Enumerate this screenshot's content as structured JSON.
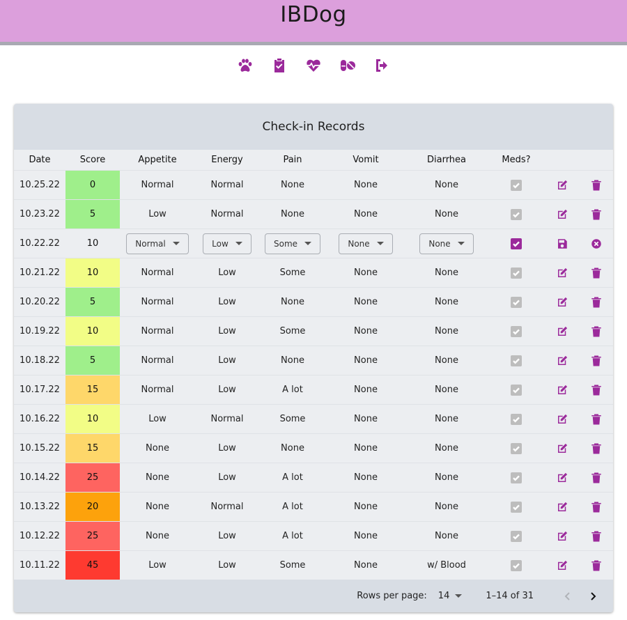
{
  "app": {
    "title": "IBDog"
  },
  "nav": [
    {
      "name": "paw-icon",
      "icon": "paw"
    },
    {
      "name": "clipboard-check-icon",
      "icon": "clipboard-check"
    },
    {
      "name": "heart-pulse-icon",
      "icon": "heart-pulse"
    },
    {
      "name": "pills-icon",
      "icon": "pills"
    },
    {
      "name": "logout-icon",
      "icon": "logout"
    }
  ],
  "table": {
    "title": "Check-in Records",
    "columns": [
      "Date",
      "Score",
      "Appetite",
      "Energy",
      "Pain",
      "Vomit",
      "Diarrhea",
      "Meds?"
    ],
    "score_colors": {
      "0": "#9fef8b",
      "5": "#9fef8b",
      "10": "#f2fd86",
      "15": "#fed76a",
      "20": "#fda20c",
      "25": "#fe6460",
      "45": "#fe3a30"
    },
    "accent_color": "#9b2a9b",
    "rows": [
      {
        "date": "10.25.22",
        "score": "0",
        "appetite": "Normal",
        "energy": "Normal",
        "pain": "None",
        "vomit": "None",
        "diarrhea": "None",
        "meds": true
      },
      {
        "date": "10.23.22",
        "score": "5",
        "appetite": "Low",
        "energy": "Normal",
        "pain": "None",
        "vomit": "None",
        "diarrhea": "None",
        "meds": true
      },
      {
        "date": "10.22.22",
        "score": "10",
        "appetite": "Normal",
        "energy": "Low",
        "pain": "Some",
        "vomit": "None",
        "diarrhea": "None",
        "meds": true,
        "editing": true
      },
      {
        "date": "10.21.22",
        "score": "10",
        "appetite": "Normal",
        "energy": "Low",
        "pain": "Some",
        "vomit": "None",
        "diarrhea": "None",
        "meds": true
      },
      {
        "date": "10.20.22",
        "score": "5",
        "appetite": "Normal",
        "energy": "Low",
        "pain": "None",
        "vomit": "None",
        "diarrhea": "None",
        "meds": true
      },
      {
        "date": "10.19.22",
        "score": "10",
        "appetite": "Normal",
        "energy": "Low",
        "pain": "Some",
        "vomit": "None",
        "diarrhea": "None",
        "meds": true
      },
      {
        "date": "10.18.22",
        "score": "5",
        "appetite": "Normal",
        "energy": "Low",
        "pain": "None",
        "vomit": "None",
        "diarrhea": "None",
        "meds": true
      },
      {
        "date": "10.17.22",
        "score": "15",
        "appetite": "Normal",
        "energy": "Low",
        "pain": "A lot",
        "vomit": "None",
        "diarrhea": "None",
        "meds": true
      },
      {
        "date": "10.16.22",
        "score": "10",
        "appetite": "Low",
        "energy": "Normal",
        "pain": "Some",
        "vomit": "None",
        "diarrhea": "None",
        "meds": true
      },
      {
        "date": "10.15.22",
        "score": "15",
        "appetite": "None",
        "energy": "Low",
        "pain": "None",
        "vomit": "None",
        "diarrhea": "None",
        "meds": true
      },
      {
        "date": "10.14.22",
        "score": "25",
        "appetite": "None",
        "energy": "Low",
        "pain": "A lot",
        "vomit": "None",
        "diarrhea": "None",
        "meds": true
      },
      {
        "date": "10.13.22",
        "score": "20",
        "appetite": "None",
        "energy": "Normal",
        "pain": "A lot",
        "vomit": "None",
        "diarrhea": "None",
        "meds": true
      },
      {
        "date": "10.12.22",
        "score": "25",
        "appetite": "None",
        "energy": "Low",
        "pain": "A lot",
        "vomit": "None",
        "diarrhea": "None",
        "meds": true
      },
      {
        "date": "10.11.22",
        "score": "45",
        "appetite": "Low",
        "energy": "Low",
        "pain": "Some",
        "vomit": "None",
        "diarrhea": "w/ Blood",
        "meds": true
      }
    ]
  },
  "pagination": {
    "rows_per_page_label": "Rows per page:",
    "rows_per_page_value": "14",
    "range_text": "1–14 of 31"
  }
}
